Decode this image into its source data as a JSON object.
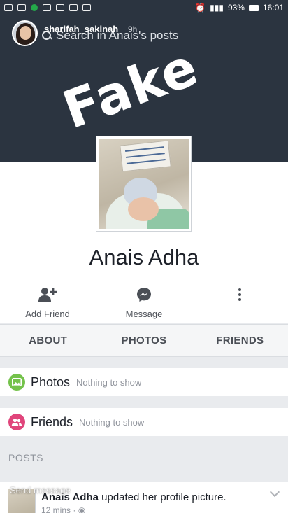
{
  "status_bar": {
    "battery": "93%",
    "time": "16:01"
  },
  "story": {
    "username": "sharifah_sakinah",
    "time_ago": "9h",
    "send_message_placeholder": "Send message"
  },
  "search": {
    "placeholder": "Search in Anais's posts"
  },
  "sticker": {
    "text": "Fake"
  },
  "profile": {
    "name": "Anais Adha"
  },
  "actions": {
    "add_friend": "Add Friend",
    "message": "Message"
  },
  "tabs": [
    "ABOUT",
    "PHOTOS",
    "FRIENDS"
  ],
  "sections": {
    "photos": {
      "title": "Photos",
      "subtitle": "Nothing to show"
    },
    "friends": {
      "title": "Friends",
      "subtitle": "Nothing to show"
    }
  },
  "posts": {
    "header": "POSTS",
    "first_post": {
      "author": "Anais Adha",
      "action": "updated her profile picture.",
      "time": "12 mins"
    }
  },
  "colors": {
    "cover": "#2b3440",
    "messenger_blue": "#1877f2",
    "photos_green": "#74c24b",
    "friends_pink": "#e0457b"
  }
}
